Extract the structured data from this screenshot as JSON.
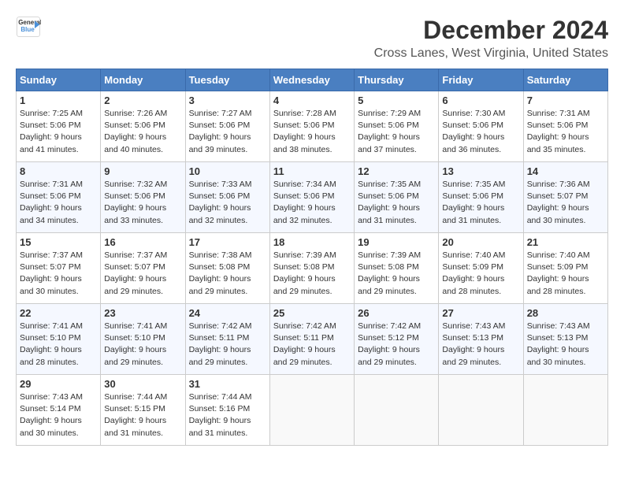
{
  "header": {
    "logo_line1": "General",
    "logo_line2": "Blue",
    "month": "December 2024",
    "location": "Cross Lanes, West Virginia, United States"
  },
  "days_of_week": [
    "Sunday",
    "Monday",
    "Tuesday",
    "Wednesday",
    "Thursday",
    "Friday",
    "Saturday"
  ],
  "weeks": [
    [
      {
        "day": "1",
        "sunrise": "7:25 AM",
        "sunset": "5:06 PM",
        "daylight": "9 hours and 41 minutes."
      },
      {
        "day": "2",
        "sunrise": "7:26 AM",
        "sunset": "5:06 PM",
        "daylight": "9 hours and 40 minutes."
      },
      {
        "day": "3",
        "sunrise": "7:27 AM",
        "sunset": "5:06 PM",
        "daylight": "9 hours and 39 minutes."
      },
      {
        "day": "4",
        "sunrise": "7:28 AM",
        "sunset": "5:06 PM",
        "daylight": "9 hours and 38 minutes."
      },
      {
        "day": "5",
        "sunrise": "7:29 AM",
        "sunset": "5:06 PM",
        "daylight": "9 hours and 37 minutes."
      },
      {
        "day": "6",
        "sunrise": "7:30 AM",
        "sunset": "5:06 PM",
        "daylight": "9 hours and 36 minutes."
      },
      {
        "day": "7",
        "sunrise": "7:31 AM",
        "sunset": "5:06 PM",
        "daylight": "9 hours and 35 minutes."
      }
    ],
    [
      {
        "day": "8",
        "sunrise": "7:31 AM",
        "sunset": "5:06 PM",
        "daylight": "9 hours and 34 minutes."
      },
      {
        "day": "9",
        "sunrise": "7:32 AM",
        "sunset": "5:06 PM",
        "daylight": "9 hours and 33 minutes."
      },
      {
        "day": "10",
        "sunrise": "7:33 AM",
        "sunset": "5:06 PM",
        "daylight": "9 hours and 32 minutes."
      },
      {
        "day": "11",
        "sunrise": "7:34 AM",
        "sunset": "5:06 PM",
        "daylight": "9 hours and 32 minutes."
      },
      {
        "day": "12",
        "sunrise": "7:35 AM",
        "sunset": "5:06 PM",
        "daylight": "9 hours and 31 minutes."
      },
      {
        "day": "13",
        "sunrise": "7:35 AM",
        "sunset": "5:06 PM",
        "daylight": "9 hours and 31 minutes."
      },
      {
        "day": "14",
        "sunrise": "7:36 AM",
        "sunset": "5:07 PM",
        "daylight": "9 hours and 30 minutes."
      }
    ],
    [
      {
        "day": "15",
        "sunrise": "7:37 AM",
        "sunset": "5:07 PM",
        "daylight": "9 hours and 30 minutes."
      },
      {
        "day": "16",
        "sunrise": "7:37 AM",
        "sunset": "5:07 PM",
        "daylight": "9 hours and 29 minutes."
      },
      {
        "day": "17",
        "sunrise": "7:38 AM",
        "sunset": "5:08 PM",
        "daylight": "9 hours and 29 minutes."
      },
      {
        "day": "18",
        "sunrise": "7:39 AM",
        "sunset": "5:08 PM",
        "daylight": "9 hours and 29 minutes."
      },
      {
        "day": "19",
        "sunrise": "7:39 AM",
        "sunset": "5:08 PM",
        "daylight": "9 hours and 29 minutes."
      },
      {
        "day": "20",
        "sunrise": "7:40 AM",
        "sunset": "5:09 PM",
        "daylight": "9 hours and 28 minutes."
      },
      {
        "day": "21",
        "sunrise": "7:40 AM",
        "sunset": "5:09 PM",
        "daylight": "9 hours and 28 minutes."
      }
    ],
    [
      {
        "day": "22",
        "sunrise": "7:41 AM",
        "sunset": "5:10 PM",
        "daylight": "9 hours and 28 minutes."
      },
      {
        "day": "23",
        "sunrise": "7:41 AM",
        "sunset": "5:10 PM",
        "daylight": "9 hours and 29 minutes."
      },
      {
        "day": "24",
        "sunrise": "7:42 AM",
        "sunset": "5:11 PM",
        "daylight": "9 hours and 29 minutes."
      },
      {
        "day": "25",
        "sunrise": "7:42 AM",
        "sunset": "5:11 PM",
        "daylight": "9 hours and 29 minutes."
      },
      {
        "day": "26",
        "sunrise": "7:42 AM",
        "sunset": "5:12 PM",
        "daylight": "9 hours and 29 minutes."
      },
      {
        "day": "27",
        "sunrise": "7:43 AM",
        "sunset": "5:13 PM",
        "daylight": "9 hours and 29 minutes."
      },
      {
        "day": "28",
        "sunrise": "7:43 AM",
        "sunset": "5:13 PM",
        "daylight": "9 hours and 30 minutes."
      }
    ],
    [
      {
        "day": "29",
        "sunrise": "7:43 AM",
        "sunset": "5:14 PM",
        "daylight": "9 hours and 30 minutes."
      },
      {
        "day": "30",
        "sunrise": "7:44 AM",
        "sunset": "5:15 PM",
        "daylight": "9 hours and 31 minutes."
      },
      {
        "day": "31",
        "sunrise": "7:44 AM",
        "sunset": "5:16 PM",
        "daylight": "9 hours and 31 minutes."
      },
      null,
      null,
      null,
      null
    ]
  ],
  "labels": {
    "sunrise": "Sunrise:",
    "sunset": "Sunset:",
    "daylight": "Daylight:"
  }
}
